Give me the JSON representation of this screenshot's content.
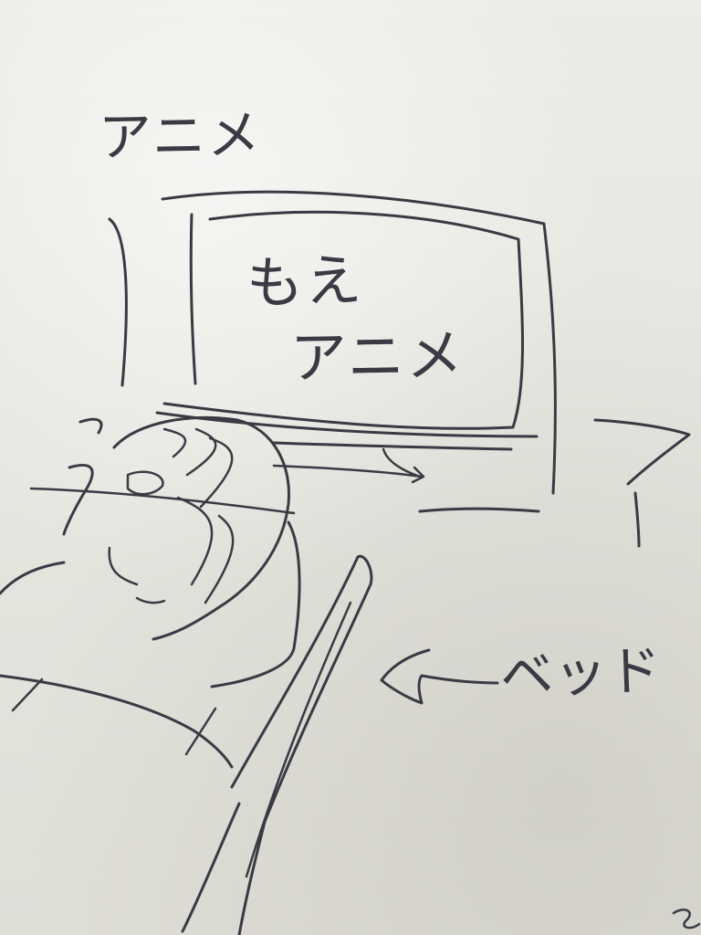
{
  "colors": {
    "paper": "#e7e6e1",
    "ink": "#3a3a44"
  },
  "labels": {
    "title": "アニメ",
    "screen_line1": "もえ",
    "screen_line2": "アニメ",
    "bed_label": "ベッド"
  },
  "icons": {
    "tv": "tv-sketch-icon",
    "person": "sleeping-person-sketch-icon",
    "arrow": "arrow-left-icon"
  }
}
